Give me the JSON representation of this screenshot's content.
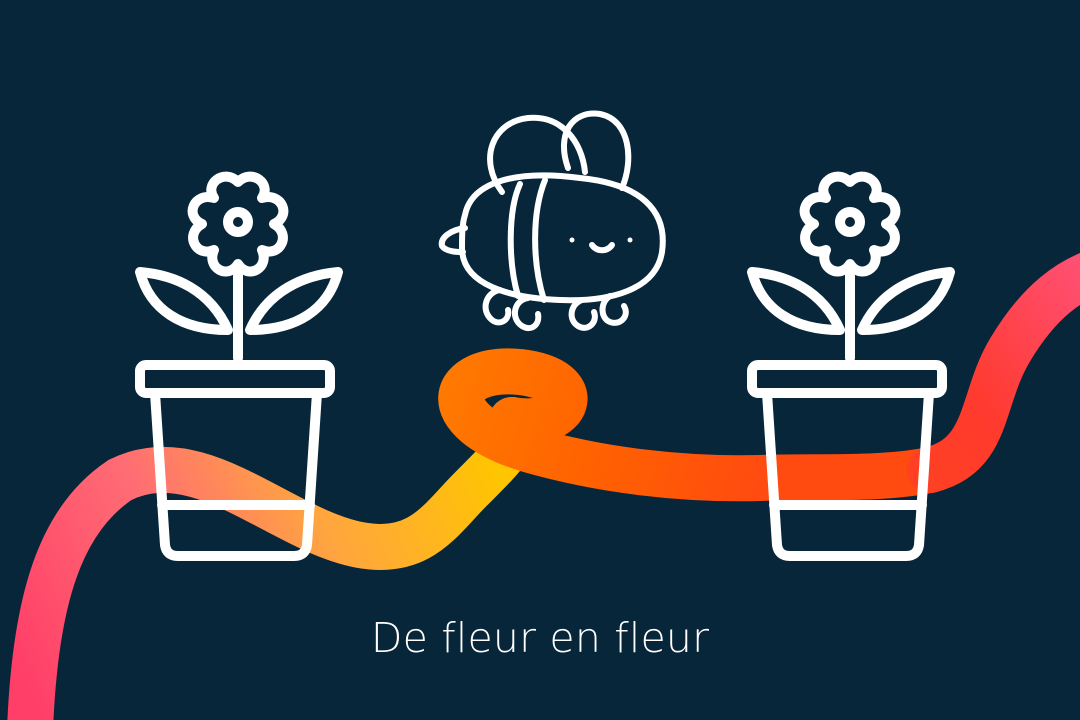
{
  "caption": "De fleur en fleur",
  "colors": {
    "background": "#07263a",
    "line_art": "#ffffff",
    "ribbon_pink": "#ff4f7b",
    "ribbon_yellow": "#ffc400",
    "ribbon_orange": "#ff6a00",
    "ribbon_red": "#ff3d2e"
  },
  "icons": {
    "left_flower": "potted-flower-icon",
    "bee": "bee-icon",
    "right_flower": "potted-flower-icon",
    "flight_path": "flight-path-ribbon"
  }
}
